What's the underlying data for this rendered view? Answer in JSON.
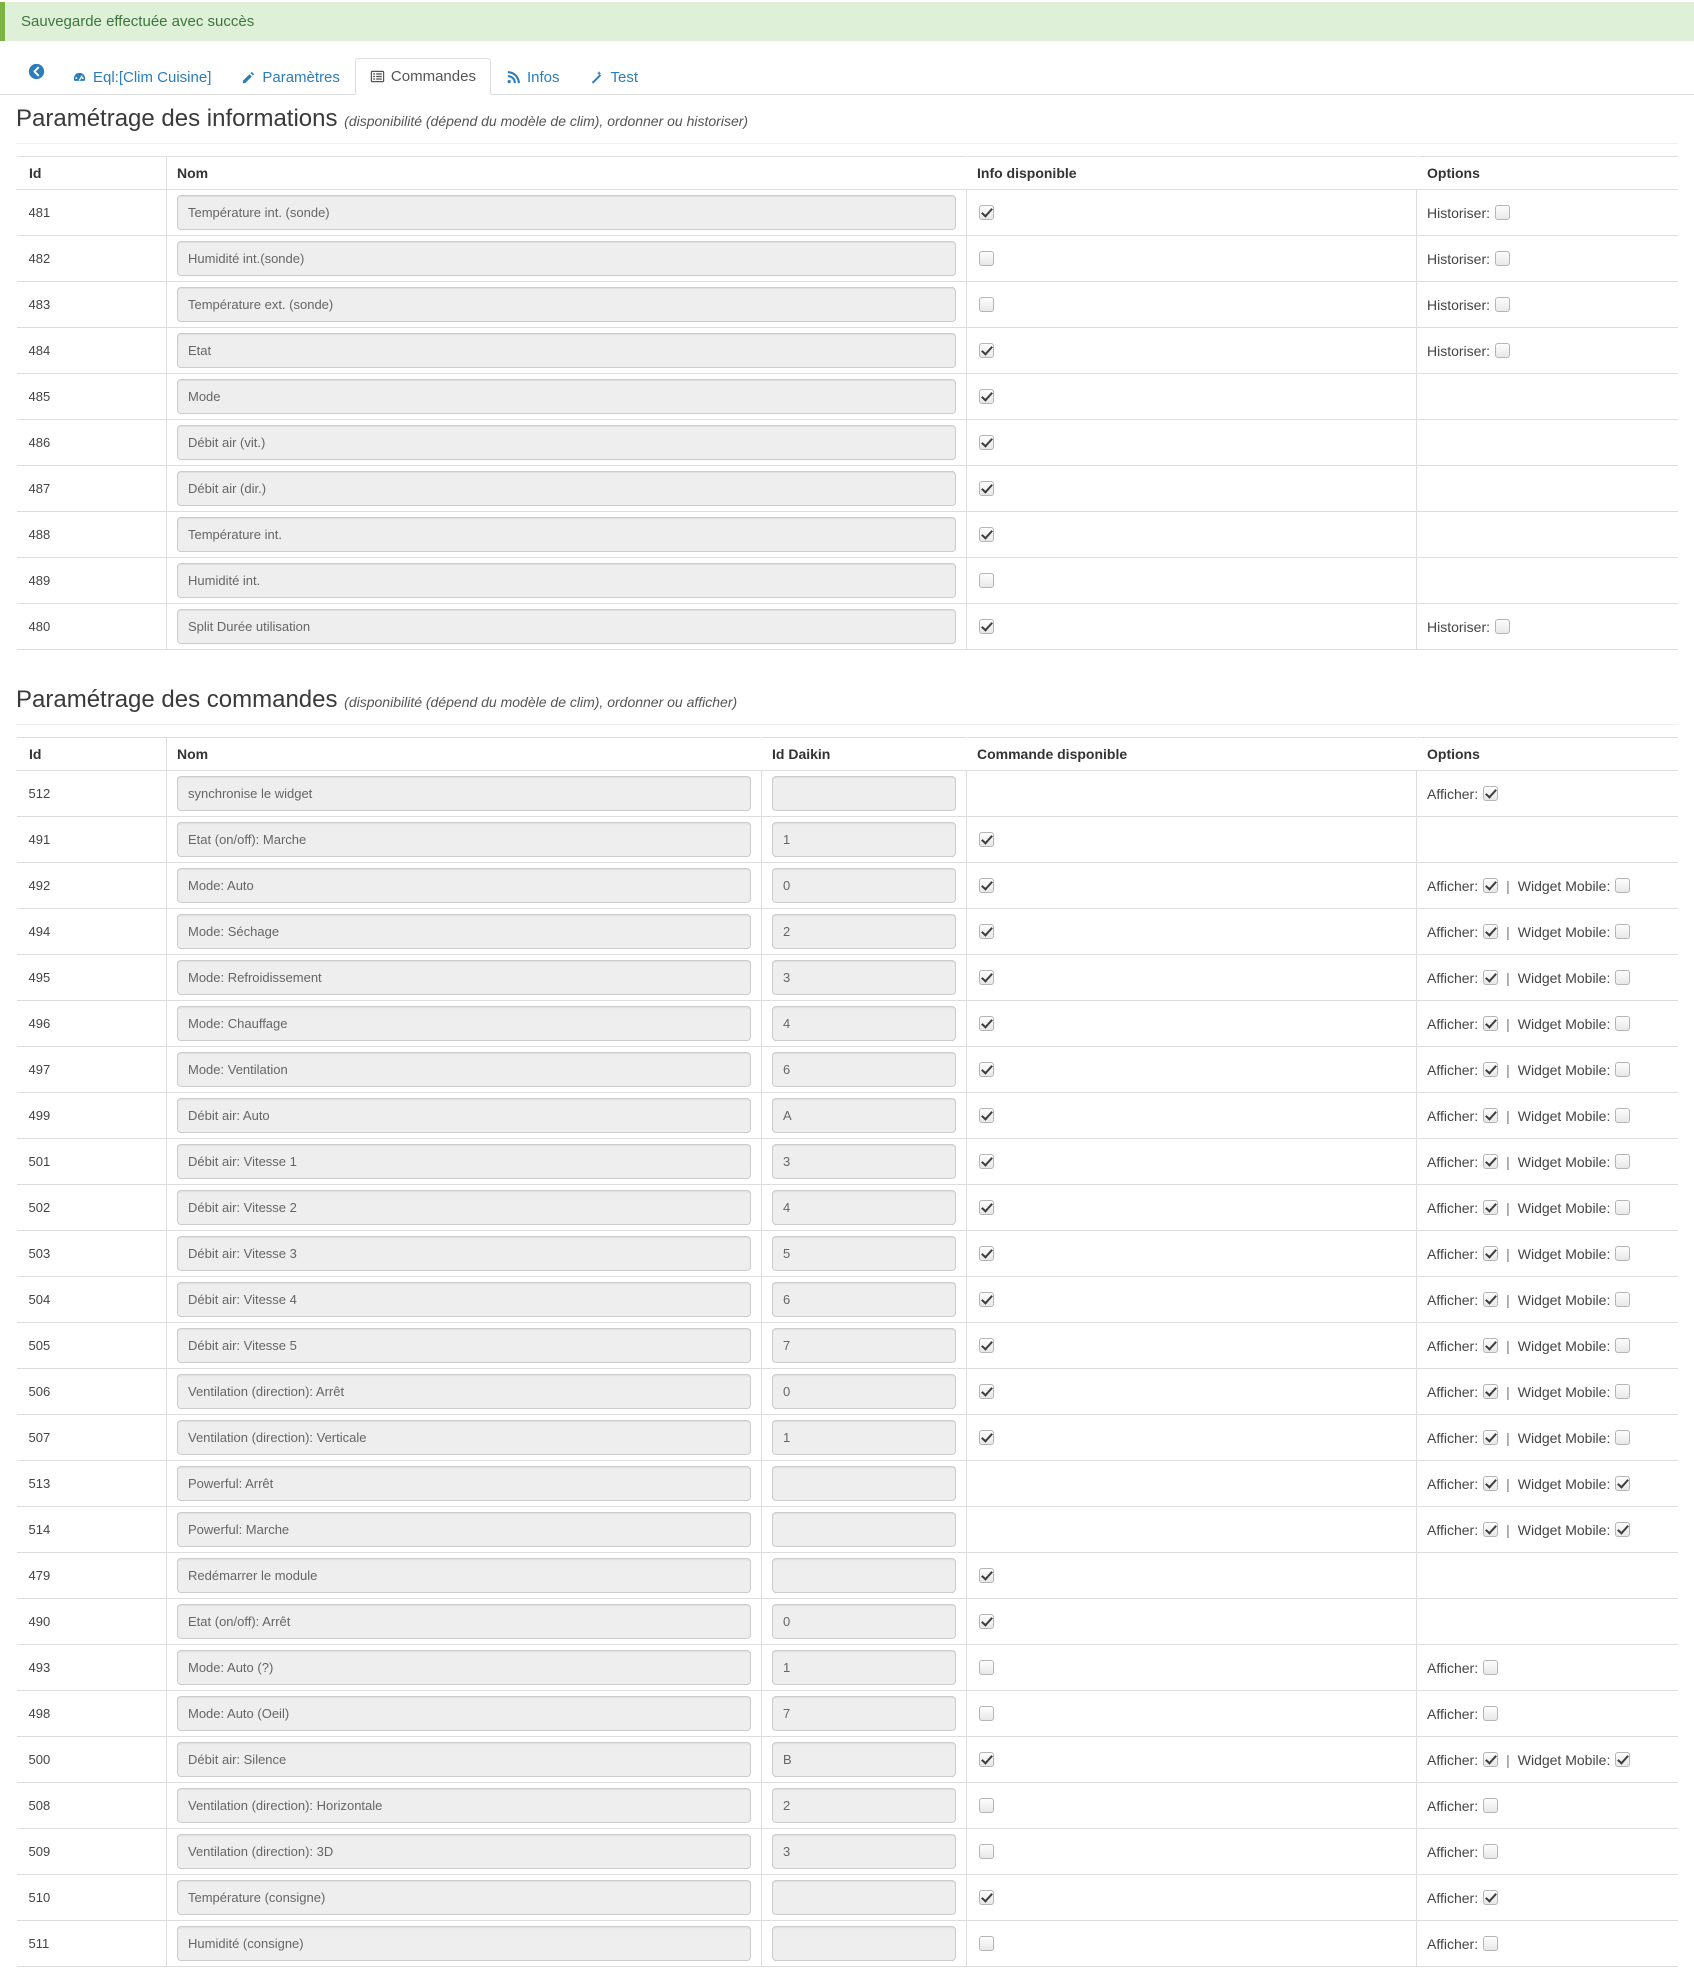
{
  "alert": {
    "message": "Sauvegarde effectuée avec succès"
  },
  "tabs": {
    "back_icon": "back-arrow-icon",
    "items": [
      {
        "label": "Eql:[Clim Cuisine]",
        "icon": "dashboard-icon",
        "active": false
      },
      {
        "label": "Paramètres",
        "icon": "edit-icon",
        "active": false
      },
      {
        "label": "Commandes",
        "icon": "list-icon",
        "active": true
      },
      {
        "label": "Infos",
        "icon": "rss-icon",
        "active": false
      },
      {
        "label": "Test",
        "icon": "wand-icon",
        "active": false
      }
    ]
  },
  "info_section": {
    "title": "Paramétrage des informations",
    "subtitle": "(disponibilité (dépend du modèle de clim), ordonner ou historiser)",
    "headers": {
      "id": "Id",
      "nom": "Nom",
      "available": "Info disponible",
      "options": "Options"
    },
    "option_label_historiser": "Historiser:",
    "rows": [
      {
        "id": "481",
        "nom": "Température int. (sonde)",
        "available": true,
        "has_historiser": true,
        "historiser": false
      },
      {
        "id": "482",
        "nom": "Humidité int.(sonde)",
        "available": false,
        "has_historiser": true,
        "historiser": false
      },
      {
        "id": "483",
        "nom": "Température ext. (sonde)",
        "available": false,
        "has_historiser": true,
        "historiser": false
      },
      {
        "id": "484",
        "nom": "Etat",
        "available": true,
        "has_historiser": true,
        "historiser": false
      },
      {
        "id": "485",
        "nom": "Mode",
        "available": true,
        "has_historiser": false,
        "historiser": false
      },
      {
        "id": "486",
        "nom": "Débit air (vit.)",
        "available": true,
        "has_historiser": false,
        "historiser": false
      },
      {
        "id": "487",
        "nom": "Débit air (dir.)",
        "available": true,
        "has_historiser": false,
        "historiser": false
      },
      {
        "id": "488",
        "nom": "Température int.",
        "available": true,
        "has_historiser": false,
        "historiser": false
      },
      {
        "id": "489",
        "nom": "Humidité int.",
        "available": false,
        "has_historiser": false,
        "historiser": false
      },
      {
        "id": "480",
        "nom": "Split Durée utilisation",
        "available": true,
        "has_historiser": true,
        "historiser": false
      }
    ]
  },
  "command_section": {
    "title": "Paramétrage des commandes",
    "subtitle": "(disponibilité (dépend du modèle de clim), ordonner ou afficher)",
    "headers": {
      "id": "Id",
      "nom": "Nom",
      "daikin": "Id Daikin",
      "available": "Commande disponible",
      "options": "Options"
    },
    "option_label_afficher": "Afficher:",
    "option_label_widget": "Widget Mobile:",
    "option_separator": "|",
    "rows": [
      {
        "id": "512",
        "nom": "synchronise le widget",
        "daikin": "",
        "has_available": false,
        "available": false,
        "has_afficher": true,
        "afficher": true,
        "has_widget": false,
        "widget": false
      },
      {
        "id": "491",
        "nom": "Etat (on/off): Marche",
        "daikin": "1",
        "has_available": true,
        "available": true,
        "has_afficher": false,
        "afficher": false,
        "has_widget": false,
        "widget": false
      },
      {
        "id": "492",
        "nom": "Mode: Auto",
        "daikin": "0",
        "has_available": true,
        "available": true,
        "has_afficher": true,
        "afficher": true,
        "has_widget": true,
        "widget": false
      },
      {
        "id": "494",
        "nom": "Mode: Séchage",
        "daikin": "2",
        "has_available": true,
        "available": true,
        "has_afficher": true,
        "afficher": true,
        "has_widget": true,
        "widget": false
      },
      {
        "id": "495",
        "nom": "Mode: Refroidissement",
        "daikin": "3",
        "has_available": true,
        "available": true,
        "has_afficher": true,
        "afficher": true,
        "has_widget": true,
        "widget": false
      },
      {
        "id": "496",
        "nom": "Mode: Chauffage",
        "daikin": "4",
        "has_available": true,
        "available": true,
        "has_afficher": true,
        "afficher": true,
        "has_widget": true,
        "widget": false
      },
      {
        "id": "497",
        "nom": "Mode: Ventilation",
        "daikin": "6",
        "has_available": true,
        "available": true,
        "has_afficher": true,
        "afficher": true,
        "has_widget": true,
        "widget": false
      },
      {
        "id": "499",
        "nom": "Débit air: Auto",
        "daikin": "A",
        "has_available": true,
        "available": true,
        "has_afficher": true,
        "afficher": true,
        "has_widget": true,
        "widget": false
      },
      {
        "id": "501",
        "nom": "Débit air: Vitesse 1",
        "daikin": "3",
        "has_available": true,
        "available": true,
        "has_afficher": true,
        "afficher": true,
        "has_widget": true,
        "widget": false
      },
      {
        "id": "502",
        "nom": "Débit air: Vitesse 2",
        "daikin": "4",
        "has_available": true,
        "available": true,
        "has_afficher": true,
        "afficher": true,
        "has_widget": true,
        "widget": false
      },
      {
        "id": "503",
        "nom": "Débit air: Vitesse 3",
        "daikin": "5",
        "has_available": true,
        "available": true,
        "has_afficher": true,
        "afficher": true,
        "has_widget": true,
        "widget": false
      },
      {
        "id": "504",
        "nom": "Débit air: Vitesse 4",
        "daikin": "6",
        "has_available": true,
        "available": true,
        "has_afficher": true,
        "afficher": true,
        "has_widget": true,
        "widget": false
      },
      {
        "id": "505",
        "nom": "Débit air: Vitesse 5",
        "daikin": "7",
        "has_available": true,
        "available": true,
        "has_afficher": true,
        "afficher": true,
        "has_widget": true,
        "widget": false
      },
      {
        "id": "506",
        "nom": "Ventilation (direction): Arrêt",
        "daikin": "0",
        "has_available": true,
        "available": true,
        "has_afficher": true,
        "afficher": true,
        "has_widget": true,
        "widget": false
      },
      {
        "id": "507",
        "nom": "Ventilation (direction): Verticale",
        "daikin": "1",
        "has_available": true,
        "available": true,
        "has_afficher": true,
        "afficher": true,
        "has_widget": true,
        "widget": false
      },
      {
        "id": "513",
        "nom": "Powerful: Arrêt",
        "daikin": "",
        "has_available": false,
        "available": false,
        "has_afficher": true,
        "afficher": true,
        "has_widget": true,
        "widget": true
      },
      {
        "id": "514",
        "nom": "Powerful: Marche",
        "daikin": "",
        "has_available": false,
        "available": false,
        "has_afficher": true,
        "afficher": true,
        "has_widget": true,
        "widget": true
      },
      {
        "id": "479",
        "nom": "Redémarrer le module",
        "daikin": "",
        "has_available": true,
        "available": true,
        "has_afficher": false,
        "afficher": false,
        "has_widget": false,
        "widget": false
      },
      {
        "id": "490",
        "nom": "Etat (on/off): Arrêt",
        "daikin": "0",
        "has_available": true,
        "available": true,
        "has_afficher": false,
        "afficher": false,
        "has_widget": false,
        "widget": false
      },
      {
        "id": "493",
        "nom": "Mode: Auto (?)",
        "daikin": "1",
        "has_available": true,
        "available": false,
        "has_afficher": true,
        "afficher": false,
        "has_widget": false,
        "widget": false
      },
      {
        "id": "498",
        "nom": "Mode: Auto (Oeil)",
        "daikin": "7",
        "has_available": true,
        "available": false,
        "has_afficher": true,
        "afficher": false,
        "has_widget": false,
        "widget": false
      },
      {
        "id": "500",
        "nom": "Débit air: Silence",
        "daikin": "B",
        "has_available": true,
        "available": true,
        "has_afficher": true,
        "afficher": true,
        "has_widget": true,
        "widget": true
      },
      {
        "id": "508",
        "nom": "Ventilation (direction): Horizontale",
        "daikin": "2",
        "has_available": true,
        "available": false,
        "has_afficher": true,
        "afficher": false,
        "has_widget": false,
        "widget": false
      },
      {
        "id": "509",
        "nom": "Ventilation (direction): 3D",
        "daikin": "3",
        "has_available": true,
        "available": false,
        "has_afficher": true,
        "afficher": false,
        "has_widget": false,
        "widget": false
      },
      {
        "id": "510",
        "nom": "Température (consigne)",
        "daikin": "",
        "has_available": true,
        "available": true,
        "has_afficher": true,
        "afficher": true,
        "has_widget": false,
        "widget": false
      },
      {
        "id": "511",
        "nom": "Humidité (consigne)",
        "daikin": "",
        "has_available": true,
        "available": false,
        "has_afficher": true,
        "afficher": false,
        "has_widget": false,
        "widget": false
      }
    ]
  }
}
